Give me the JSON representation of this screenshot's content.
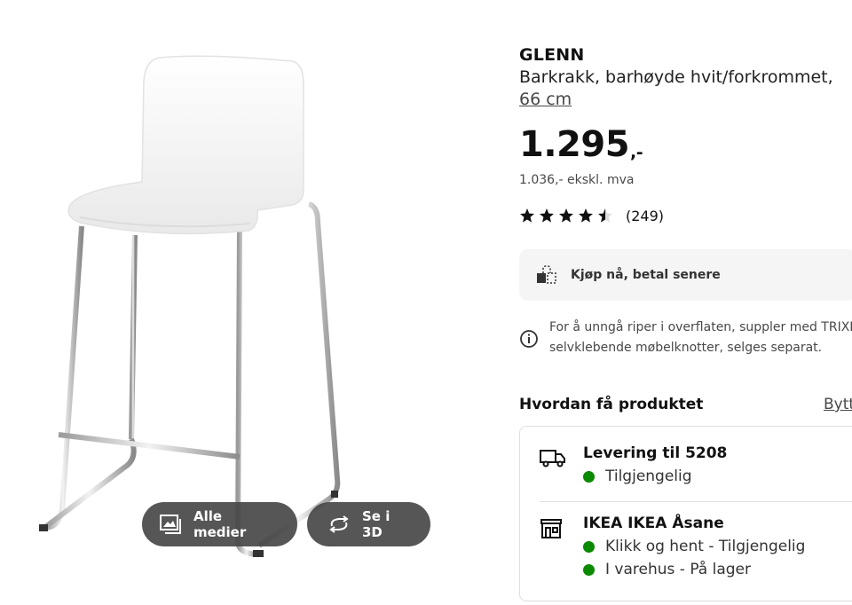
{
  "product": {
    "name": "GLENN",
    "description": "Barkrakk, barhøyde hvit/forkrommet,",
    "size_link": "66 cm",
    "price": "1.295",
    "price_suffix": ",-",
    "price_ex_vat": "1.036,- ekskl. mva",
    "rating_value": 4.5,
    "rating_max": 5,
    "review_count": "(249)"
  },
  "media": {
    "all_media_label": "Alle medier",
    "view_3d_label": "Se i 3D"
  },
  "klarna": {
    "label": "Kjøp nå, betal senere",
    "icon": "klarna-bag-icon"
  },
  "notice": {
    "line1": "For å unngå riper i overflaten, suppler med TRIXIG",
    "line2": "selvklebende møbelknotter, selges separat.",
    "icon": "info-icon"
  },
  "fulfillment": {
    "heading": "Hvordan få produktet",
    "change_link": "Bytt",
    "delivery": {
      "title": "Levering til 5208",
      "status": "Tilgjengelig",
      "status_color": "#0a8a00",
      "icon": "truck-icon"
    },
    "store": {
      "title": "IKEA IKEA Åsane",
      "status_click": "Klikk og hent - Tilgjengelig",
      "status_instore": "I varehus - På lager",
      "status_color": "#0a8a00",
      "icon": "store-icon"
    }
  }
}
